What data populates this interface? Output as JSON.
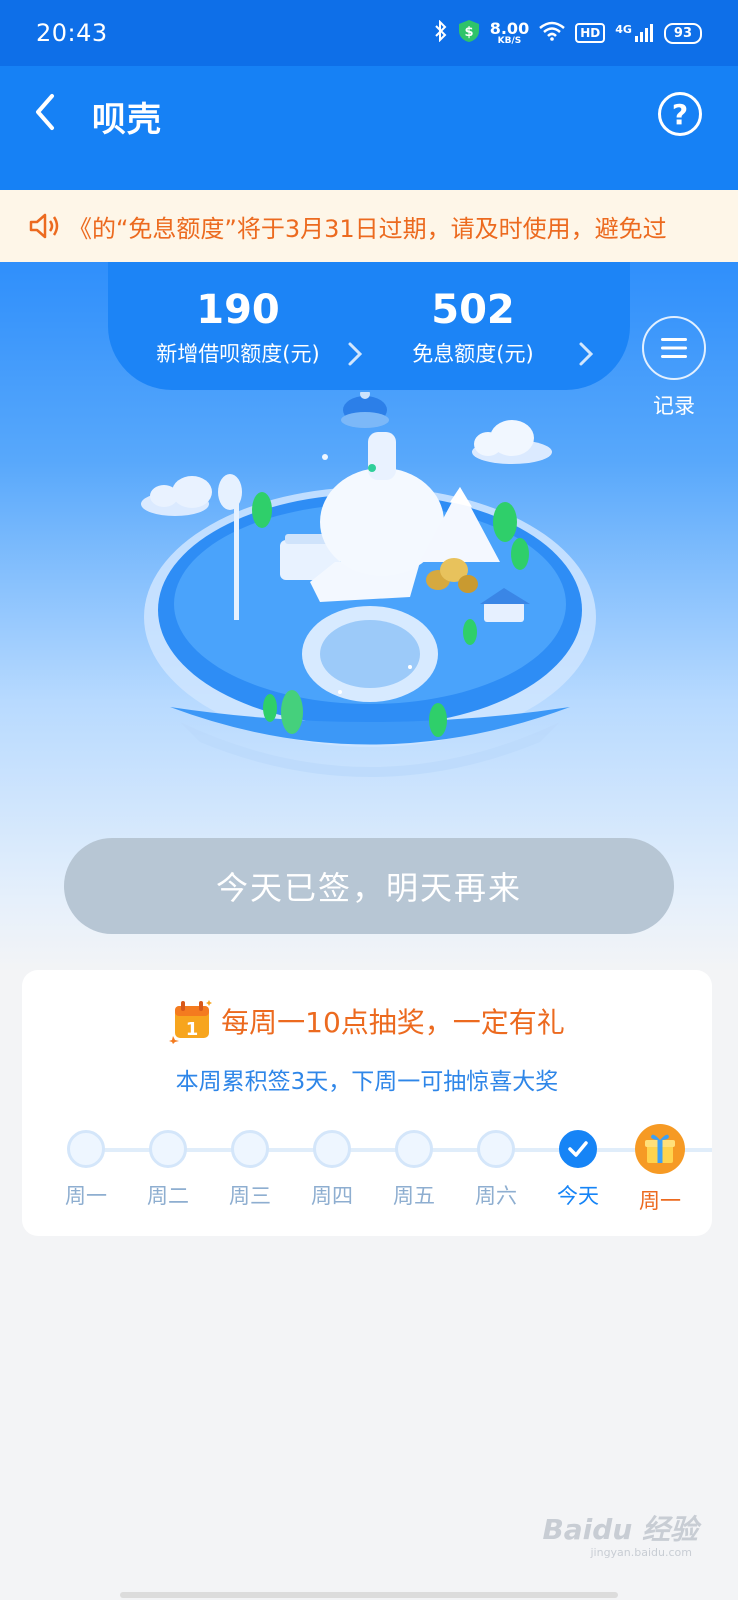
{
  "status_bar": {
    "time": "20:43",
    "net_speed": "8.00",
    "net_unit": "KB/S",
    "hd": "HD",
    "network": "4G",
    "battery": "93"
  },
  "nav": {
    "title": "呗壳"
  },
  "notice": {
    "text": "《的“免息额度”将于3月31日过期，请及时使用，避免过"
  },
  "stats": [
    {
      "value": "190",
      "label": "新增借呗额度(元)"
    },
    {
      "value": "502",
      "label": "免息额度(元)"
    }
  ],
  "record": {
    "label": "记录"
  },
  "sign": {
    "label": "今天已签，明天再来"
  },
  "weekly": {
    "title": "每周一10点抽奖，一定有礼",
    "subtitle": "本周累积签3天，下周一可抽惊喜大奖",
    "days": [
      {
        "label": "周一",
        "state": "empty"
      },
      {
        "label": "周二",
        "state": "empty"
      },
      {
        "label": "周三",
        "state": "empty"
      },
      {
        "label": "周四",
        "state": "empty"
      },
      {
        "label": "周五",
        "state": "empty"
      },
      {
        "label": "周六",
        "state": "empty"
      },
      {
        "label": "今天",
        "state": "checked"
      },
      {
        "label": "周一",
        "state": "gift"
      }
    ]
  },
  "watermark": {
    "text": "Baidu 经验",
    "sub": "jingyan.baidu.com"
  },
  "colors": {
    "primary_blue": "#1681f5",
    "notice_orange": "#ec6a1f",
    "notice_bg": "#fef6e8",
    "disabled_button": "#b7c6d4"
  }
}
